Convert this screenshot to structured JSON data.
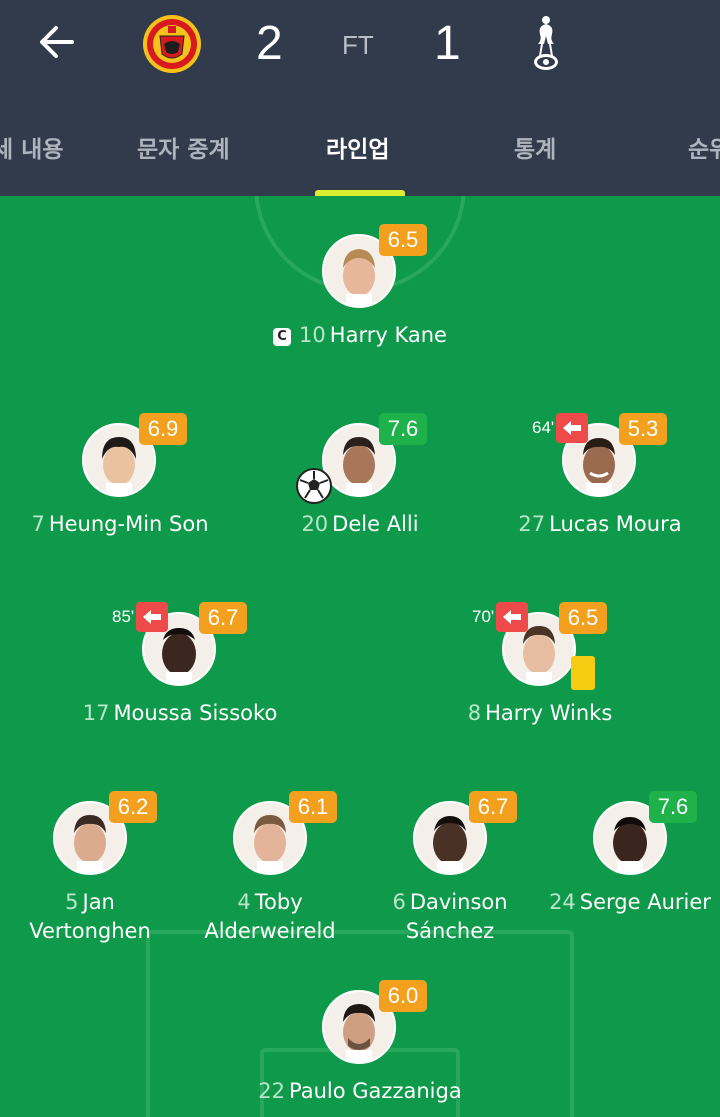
{
  "match": {
    "home_score": "2",
    "away_score": "1",
    "status": "FT"
  },
  "tabs": [
    {
      "label": "세 내용"
    },
    {
      "label": "문자 중계"
    },
    {
      "label": "라인업"
    },
    {
      "label": "통계"
    },
    {
      "label": "순위"
    }
  ],
  "icons": {
    "back": "arrow-left-icon",
    "home_crest": "manchester-united-crest",
    "away_crest": "tottenham-crest",
    "captain_mark": "C"
  },
  "colors": {
    "header_bg": "#313b4b",
    "pitch": "#0e9a4a",
    "rating_orange": "#f4a01f",
    "rating_green": "#1fb24b",
    "sub_red": "#ef4a4a",
    "tab_underline": "#d9ef2f"
  },
  "players": {
    "kane": {
      "number": "10",
      "name": "Harry Kane",
      "rating": "6.5"
    },
    "son": {
      "number": "7",
      "name": "Heung-Min Son",
      "rating": "6.9"
    },
    "alli": {
      "number": "20",
      "name": "Dele Alli",
      "rating": "7.6"
    },
    "moura": {
      "number": "27",
      "name": "Lucas Moura",
      "rating": "5.3",
      "sub_minute": "64'"
    },
    "sissoko": {
      "number": "17",
      "name": "Moussa Sissoko",
      "rating": "6.7",
      "sub_minute": "85'"
    },
    "winks": {
      "number": "8",
      "name": "Harry Winks",
      "rating": "6.5",
      "sub_minute": "70'"
    },
    "vertonghen": {
      "number": "5",
      "name_line1": "Jan",
      "name_line2": "Vertonghen",
      "rating": "6.2"
    },
    "alderweireld": {
      "number": "4",
      "name_line1": "Toby",
      "name_line2": "Alderweireld",
      "rating": "6.1"
    },
    "sanchez": {
      "number": "6",
      "name_line1": "Davinson",
      "name_line2": "Sánchez",
      "rating": "6.7"
    },
    "aurier": {
      "number": "24",
      "name": "Serge Aurier",
      "rating": "7.6"
    },
    "gazzaniga": {
      "number": "22",
      "name": "Paulo Gazzaniga",
      "rating": "6.0"
    }
  }
}
